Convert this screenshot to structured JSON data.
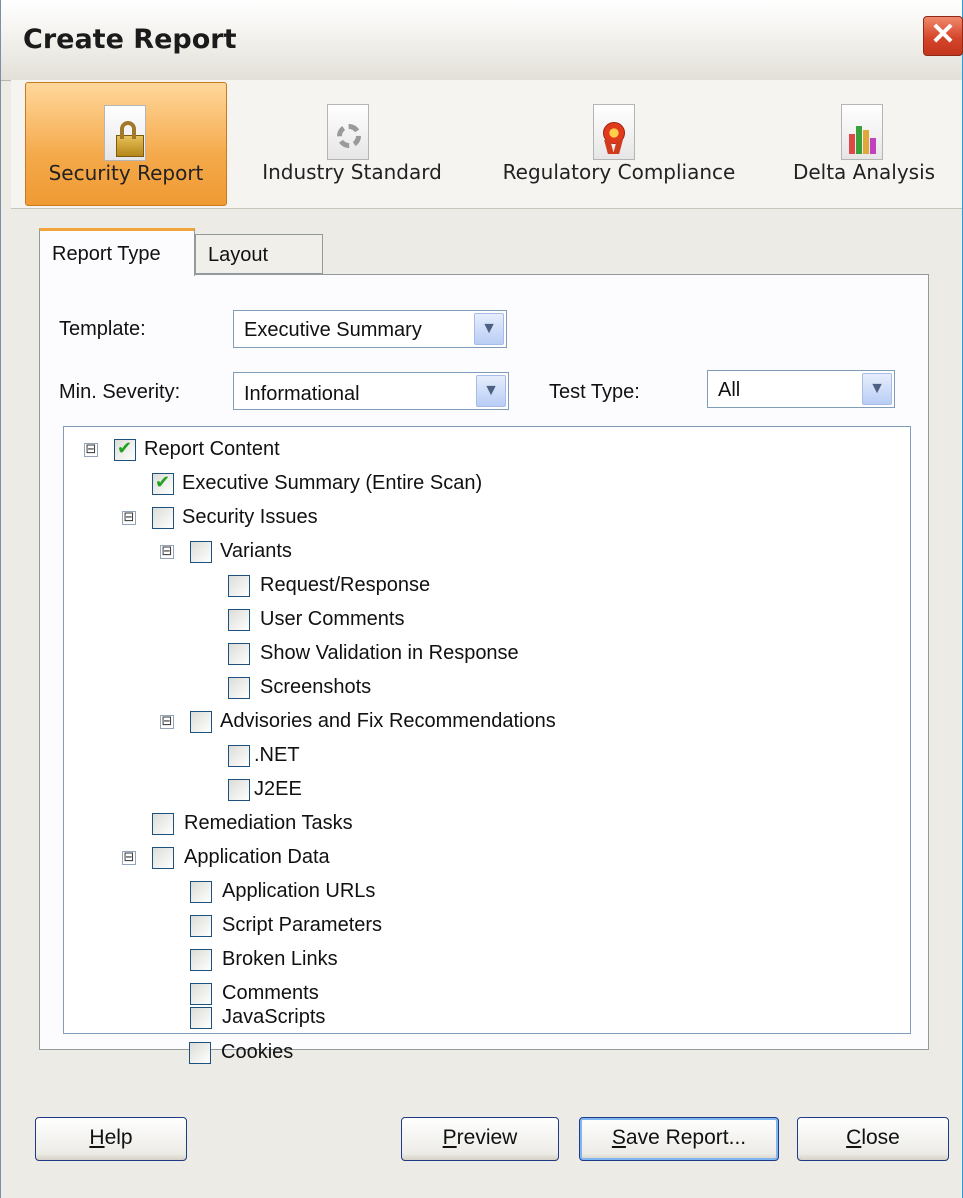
{
  "window": {
    "title": "Create Report",
    "close_glyph": "✕"
  },
  "toolbar": {
    "items": [
      {
        "label": "Security Report",
        "icon": "lock-document-icon",
        "active": true
      },
      {
        "label": "Industry Standard",
        "icon": "gear-document-icon",
        "active": false
      },
      {
        "label": "Regulatory Compliance",
        "icon": "ribbon-document-icon",
        "active": false
      },
      {
        "label": "Delta Analysis",
        "icon": "chart-document-icon",
        "active": false
      }
    ]
  },
  "tabs": [
    {
      "label": "Report Type",
      "active": true
    },
    {
      "label": "Layout",
      "active": false
    }
  ],
  "form": {
    "template_label": "Template:",
    "template_value": "Executive Summary",
    "min_severity_label": "Min. Severity:",
    "min_severity_value": "Informational",
    "test_type_label": "Test Type:",
    "test_type_value": "All"
  },
  "tree": [
    {
      "label": "Report Content",
      "checked": true,
      "expander": "⊟"
    },
    {
      "label": "Executive Summary (Entire Scan)",
      "checked": true
    },
    {
      "label": "Security Issues",
      "checked": false,
      "expander": "⊟"
    },
    {
      "label": "Variants",
      "checked": false,
      "expander": "⊟"
    },
    {
      "label": "Request/Response",
      "checked": false
    },
    {
      "label": "User Comments",
      "checked": false
    },
    {
      "label": "Show Validation in Response",
      "checked": false
    },
    {
      "label": "Screenshots",
      "checked": false
    },
    {
      "label": "Advisories and Fix Recommendations",
      "checked": false,
      "expander": "⊟"
    },
    {
      "label": ".NET",
      "checked": false
    },
    {
      "label": "J2EE",
      "checked": false
    },
    {
      "label": "Remediation Tasks",
      "checked": false
    },
    {
      "label": "Application Data",
      "checked": false,
      "expander": "⊟"
    },
    {
      "label": "Application URLs",
      "checked": false
    },
    {
      "label": "Script Parameters",
      "checked": false
    },
    {
      "label": "Broken Links",
      "checked": false
    },
    {
      "label": "Comments",
      "checked": false
    },
    {
      "label": "JavaScripts",
      "checked": false
    },
    {
      "label": "Cookies",
      "checked": false
    }
  ],
  "buttons": {
    "help": {
      "mnemonic": "H",
      "rest": "elp"
    },
    "preview": {
      "mnemonic": "P",
      "rest": "review"
    },
    "save": {
      "mnemonic": "S",
      "rest": "ave Report..."
    },
    "close": {
      "mnemonic": "C",
      "rest": "lose"
    }
  }
}
